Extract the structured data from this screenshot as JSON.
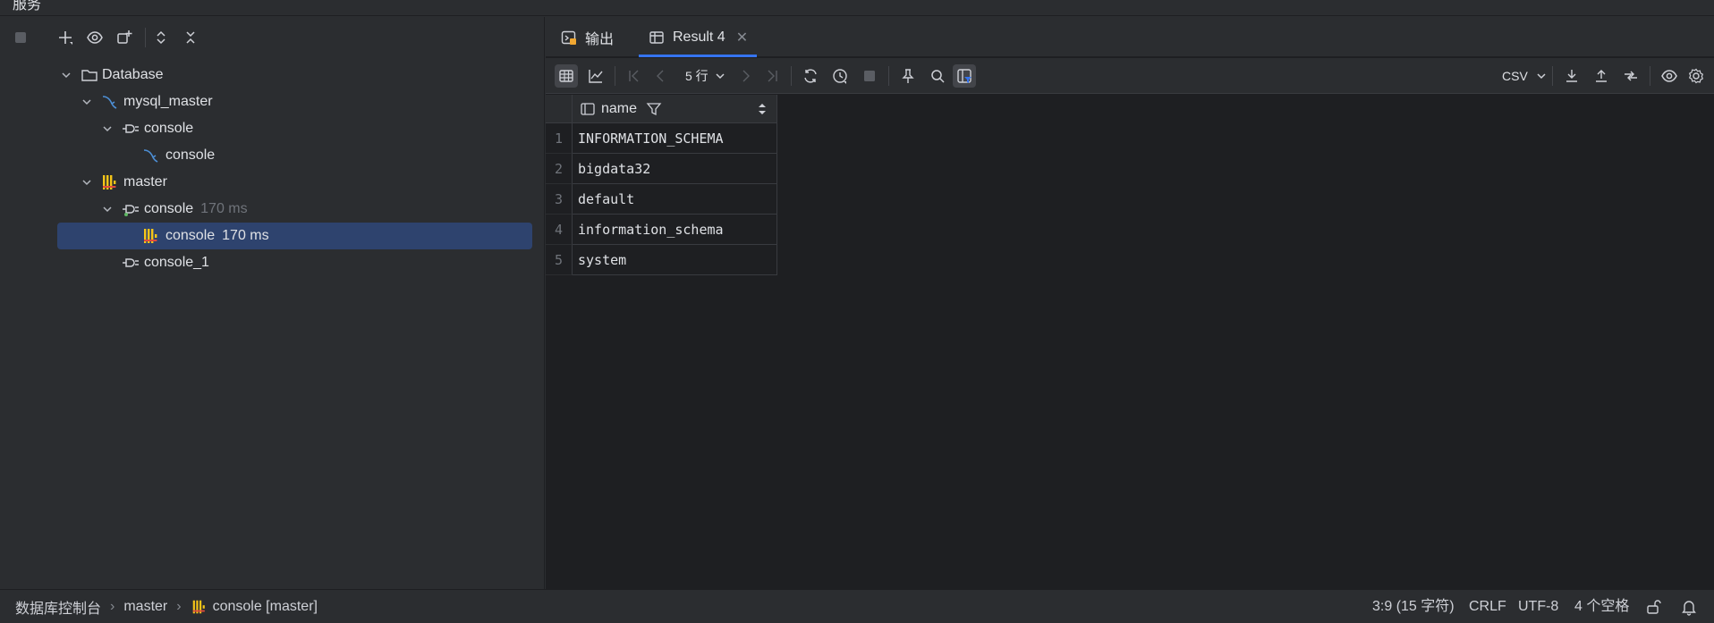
{
  "window": {
    "title_fragment": "服务"
  },
  "left_toolbar": {
    "icons": [
      "square-icon",
      "add-icon",
      "eye-icon",
      "new-console-icon",
      "expand-all-icon",
      "collapse-all-icon"
    ]
  },
  "tree": {
    "database": {
      "label": "Database"
    },
    "mysql_master": {
      "label": "mysql_master"
    },
    "mysql_console_group": {
      "label": "console"
    },
    "mysql_console": {
      "label": "console"
    },
    "master": {
      "label": "master"
    },
    "master_console_group": {
      "label": "console",
      "timing": "170 ms"
    },
    "master_console": {
      "label": "console",
      "timing": "170 ms"
    },
    "console_1": {
      "label": "console_1"
    }
  },
  "tabs": {
    "output": {
      "label": "输出"
    },
    "result": {
      "label": "Result 4"
    }
  },
  "results_toolbar": {
    "row_count": "5 行",
    "export_format": "CSV"
  },
  "grid": {
    "columns": [
      "name"
    ],
    "rows": [
      {
        "num": "1",
        "name": "INFORMATION_SCHEMA"
      },
      {
        "num": "2",
        "name": "bigdata32"
      },
      {
        "num": "3",
        "name": "default"
      },
      {
        "num": "4",
        "name": "information_schema"
      },
      {
        "num": "5",
        "name": "system"
      }
    ]
  },
  "status_bar": {
    "breadcrumb": [
      "数据库控制台",
      "master",
      "console [master]"
    ],
    "position": "3:9 (15 字符)",
    "line_ending": "CRLF",
    "encoding": "UTF-8",
    "indent": "4 个空格"
  },
  "colors": {
    "accent": "#3574f0",
    "selection": "#2e436e",
    "clickhouse_yellow": "#f5c518",
    "mysql_blue": "#4d8fd6"
  }
}
